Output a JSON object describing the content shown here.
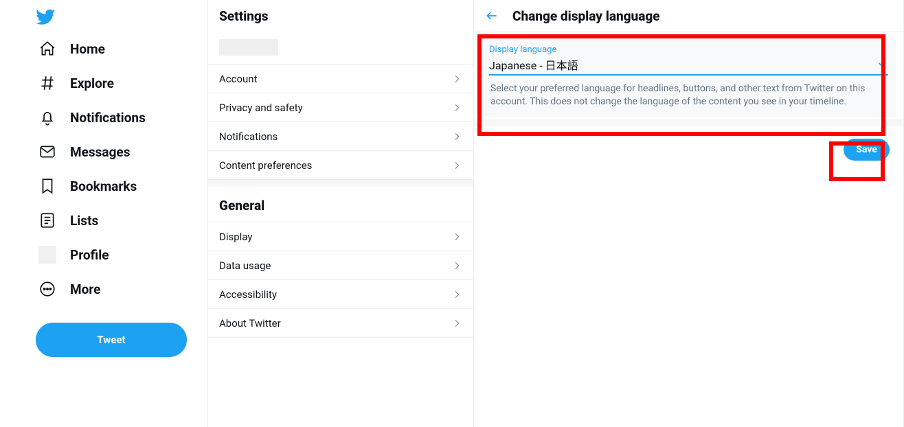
{
  "nav": {
    "home": "Home",
    "explore": "Explore",
    "notifications": "Notifications",
    "messages": "Messages",
    "bookmarks": "Bookmarks",
    "lists": "Lists",
    "profile": "Profile",
    "more": "More",
    "tweet": "Tweet"
  },
  "settings": {
    "title": "Settings",
    "items": {
      "account": "Account",
      "privacy": "Privacy and safety",
      "notifications": "Notifications",
      "content": "Content preferences"
    },
    "general_title": "General",
    "general": {
      "display": "Display",
      "data": "Data usage",
      "accessibility": "Accessibility",
      "about": "About Twitter"
    }
  },
  "detail": {
    "title": "Change display language",
    "lang_label": "Display language",
    "lang_value": "Japanese - 日本語",
    "lang_desc": "Select your preferred language for headlines, buttons, and other text from Twitter on this account. This does not change the language of the content you see in your timeline.",
    "save": "Save"
  }
}
